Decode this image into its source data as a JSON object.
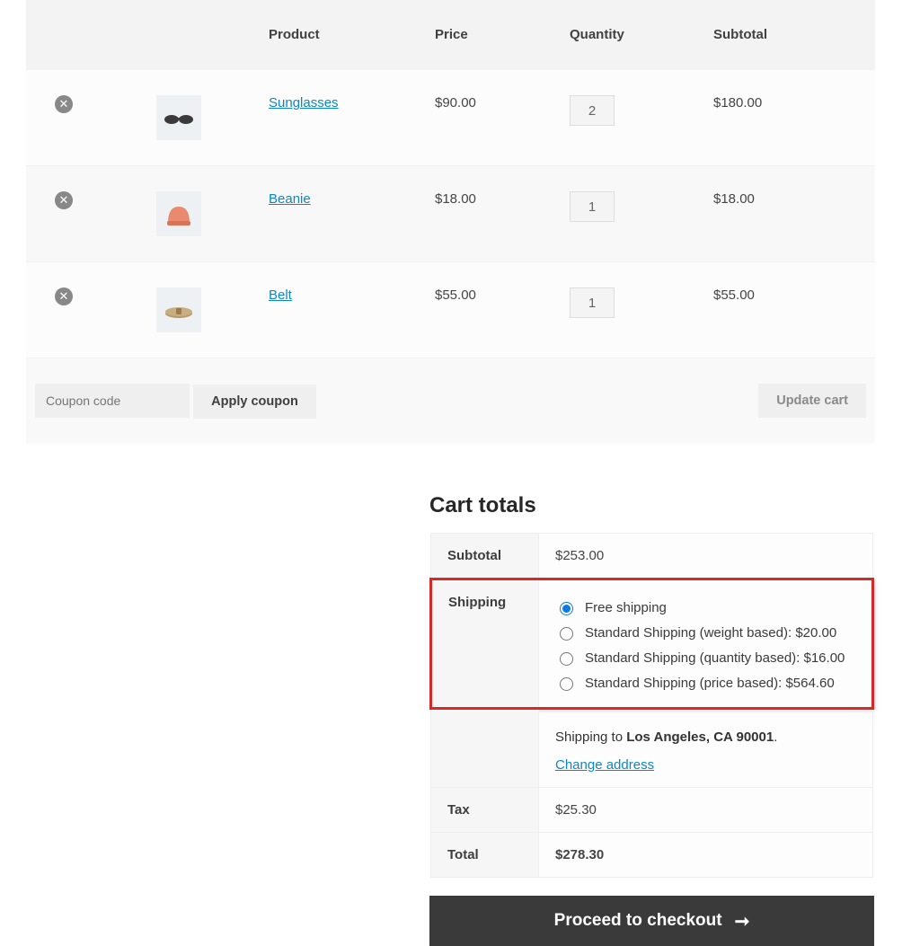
{
  "headers": {
    "product": "Product",
    "price": "Price",
    "quantity": "Quantity",
    "subtotal": "Subtotal"
  },
  "items": [
    {
      "name": "Sunglasses",
      "price": "$90.00",
      "qty": "2",
      "subtotal": "$180.00"
    },
    {
      "name": "Beanie",
      "price": "$18.00",
      "qty": "1",
      "subtotal": "$18.00"
    },
    {
      "name": "Belt",
      "price": "$55.00",
      "qty": "1",
      "subtotal": "$55.00"
    }
  ],
  "coupon": {
    "placeholder": "Coupon code",
    "apply": "Apply coupon",
    "update": "Update cart"
  },
  "totals_title": "Cart totals",
  "totals": {
    "subtotal_label": "Subtotal",
    "subtotal": "$253.00",
    "shipping_label": "Shipping",
    "shipping_options": [
      "Free shipping",
      "Standard Shipping (weight based): $20.00",
      "Standard Shipping (quantity based): $16.00",
      "Standard Shipping (price based): $564.60"
    ],
    "shipping_to_prefix": "Shipping to ",
    "shipping_to_dest": "Los Angeles, CA 90001",
    "shipping_to_suffix": ".",
    "change_address": "Change address",
    "tax_label": "Tax",
    "tax": "$25.30",
    "total_label": "Total",
    "total": "$278.30"
  },
  "checkout": "Proceed to checkout"
}
